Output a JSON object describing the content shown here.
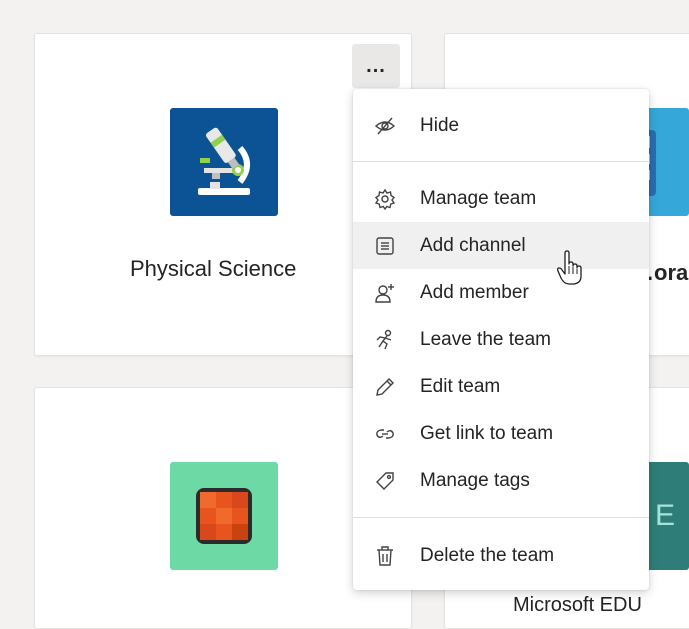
{
  "teams": [
    {
      "name": "Physical Science",
      "icon": "microscope-icon",
      "tile_color": "#0b5394"
    },
    {
      "name": "…ora",
      "icon": "calculator-icon",
      "tile_color": "#35a7d8"
    },
    {
      "name": "",
      "icon": "rubik-cube-icon",
      "tile_color": "#6ddaa6"
    },
    {
      "name": "Microsoft EDU",
      "icon": "edu-icon",
      "tile_color": "#2e7d78"
    }
  ],
  "more_options": {
    "label": "..."
  },
  "menu": {
    "items": [
      {
        "label": "Hide",
        "icon": "hide-icon"
      },
      {
        "label": "Manage team",
        "icon": "gear-icon"
      },
      {
        "label": "Add channel",
        "icon": "channel-icon"
      },
      {
        "label": "Add member",
        "icon": "add-member-icon"
      },
      {
        "label": "Leave the team",
        "icon": "leave-icon"
      },
      {
        "label": "Edit team",
        "icon": "pencil-icon"
      },
      {
        "label": "Get link to team",
        "icon": "link-icon"
      },
      {
        "label": "Manage tags",
        "icon": "tag-icon"
      },
      {
        "label": "Delete the team",
        "icon": "trash-icon"
      }
    ],
    "hovered_item": "Add channel"
  },
  "colors": {
    "background": "#f3f2f1",
    "card": "#ffffff",
    "hover": "#f0f0f0",
    "text": "#252423"
  }
}
